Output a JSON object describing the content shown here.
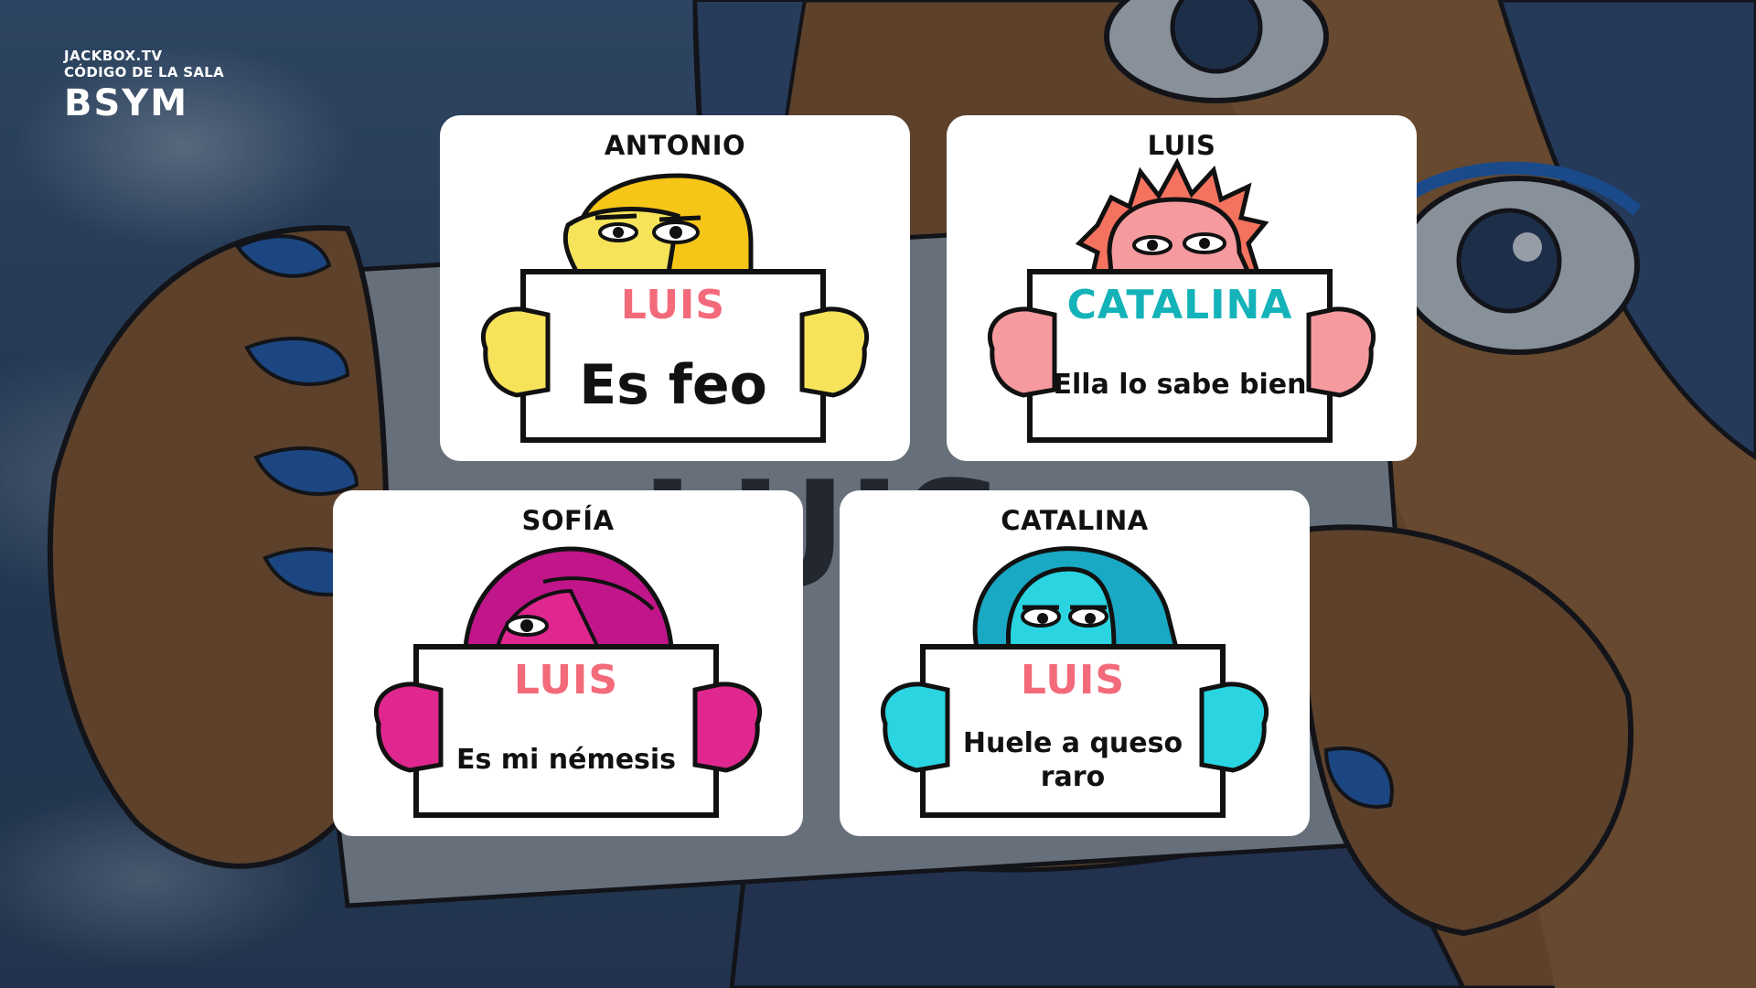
{
  "room": {
    "site": "JACKBOX.TV",
    "label": "CÓDIGO DE LA SALA",
    "code": "BSYM"
  },
  "colors": {
    "target_red": "#f36a7a",
    "target_teal": "#14b3b9",
    "antonio": "#f5c518",
    "luis": "#f59a9e",
    "sofia": "#e0278f",
    "catalina": "#2ad4e0"
  },
  "cards": [
    {
      "player": "ANTONIO",
      "target": "LUIS",
      "answer": "Es feo",
      "avatar": "blonde-character-icon"
    },
    {
      "player": "LUIS",
      "target": "CATALINA",
      "answer": "Ella lo sabe bien",
      "avatar": "spiky-pink-character-icon"
    },
    {
      "player": "SOFÍA",
      "target": "LUIS",
      "answer": "Es mi némesis",
      "avatar": "magenta-character-icon"
    },
    {
      "player": "CATALINA",
      "target": "LUIS",
      "answer": "Huele a queso raro",
      "avatar": "cyan-character-icon"
    }
  ]
}
